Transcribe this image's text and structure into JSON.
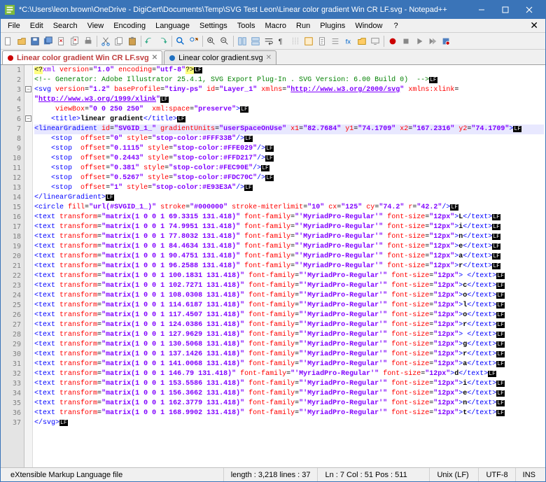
{
  "window": {
    "title": "*C:\\Users\\leon.brown\\OneDrive - DigiCert\\Documents\\Temp\\SVG Test Leon\\Linear color gradient Win CR LF.svg - Notepad++"
  },
  "menu": {
    "items": [
      "File",
      "Edit",
      "Search",
      "View",
      "Encoding",
      "Language",
      "Settings",
      "Tools",
      "Macro",
      "Run",
      "Plugins",
      "Window",
      "?"
    ]
  },
  "tabs": [
    {
      "label": "Linear color gradient Win CR LF.svg",
      "active": true,
      "dirty": true
    },
    {
      "label": "Linear color gradient.svg",
      "active": false,
      "dirty": false
    }
  ],
  "gutter_lines": 37,
  "code_lines": [
    {
      "html": "<span class='c-xml'>&lt;?</span><span class='c-decl'>xml</span> <span class='c-attr'>version</span>=<span class='c-str'>\"1.0\"</span> <span class='c-attr'>encoding</span>=<span class='c-str'>\"utf-8\"</span><span class='c-xml'>?&gt;</span><span class='c-lf'>LF</span>"
    },
    {
      "html": "<span class='c-comment'>&lt;!-- Generator: Adobe Illustrator 25.4.1, SVG Export Plug-In . SVG Version: 6.00 Build 0)  --&gt;</span><span class='c-lf'>LF</span>"
    },
    {
      "html": "<span class='c-tag'>&lt;svg</span> <span class='c-attr'>version</span>=<span class='c-str'>\"1.2\"</span> <span class='c-attr'>baseProfile</span>=<span class='c-str'>\"tiny-ps\"</span> <span class='c-attr'>id</span>=<span class='c-str'>\"Layer_1\"</span> <span class='c-attr'>xmlns</span>=<span class='c-str'>\"<u>http://www.w3.org/2000/svg</u>\"</span> <span class='c-attr'>xmlns:xlink</span>="
    },
    {
      "html": "<span class='c-str'>\"<u>http://www.w3.org/1999/xlink</u>\"</span><span class='c-lf'>LF</span>"
    },
    {
      "html": "     <span class='c-attr'>viewBox</span>=<span class='c-str'>\"0 0 250 250\"</span>  <span class='c-attr'>xml:space</span>=<span class='c-str'>\"preserve\"</span><span class='c-tag'>&gt;</span><span class='c-lf'>LF</span>"
    },
    {
      "html": "    <span class='c-tag'>&lt;title&gt;</span><span class='c-text'>linear gradient</span><span class='c-tag'>&lt;/title&gt;</span><span class='c-lf'>LF</span>"
    },
    {
      "html": "<span class='c-tag'>&lt;linearGradient</span> <span class='c-attr'>id</span>=<span class='c-str'>\"SVGID_1_\"</span> <span class='c-attr'>gradientUnits</span>=<span class='c-str'>\"userSpaceOnUse\"</span> <span class='c-attr'>x1</span>=<span class='c-str'>\"82.7684\"</span> <span class='c-attr'>y1</span>=<span class='c-str'>\"74.1709\"</span> <span class='c-attr'>x2</span>=<span class='c-str'>\"167.2316\"</span> <span class='c-attr'>y2</span>=<span class='c-str'>\"74.1709\"</span><span class='c-tag'>&gt;</span><span class='c-lf'>LF</span>",
      "hl": true
    },
    {
      "html": "    <span class='c-tag'>&lt;stop</span>  <span class='c-attr'>offset</span>=<span class='c-str'>\"0\"</span> <span class='c-attr'>style</span>=<span class='c-str'>\"stop-color:#FFF33B\"</span><span class='c-tag'>/&gt;</span><span class='c-lf'>LF</span>"
    },
    {
      "html": "    <span class='c-tag'>&lt;stop</span>  <span class='c-attr'>offset</span>=<span class='c-str'>\"0.1115\"</span> <span class='c-attr'>style</span>=<span class='c-str'>\"stop-color:#FFE029\"</span><span class='c-tag'>/&gt;</span><span class='c-lf'>LF</span>"
    },
    {
      "html": "    <span class='c-tag'>&lt;stop</span>  <span class='c-attr'>offset</span>=<span class='c-str'>\"0.2443\"</span> <span class='c-attr'>style</span>=<span class='c-str'>\"stop-color:#FFD217\"</span><span class='c-tag'>/&gt;</span><span class='c-lf'>LF</span>"
    },
    {
      "html": "    <span class='c-tag'>&lt;stop</span>  <span class='c-attr'>offset</span>=<span class='c-str'>\"0.381\"</span> <span class='c-attr'>style</span>=<span class='c-str'>\"stop-color:#FEC90E\"</span><span class='c-tag'>/&gt;</span><span class='c-lf'>LF</span>"
    },
    {
      "html": "    <span class='c-tag'>&lt;stop</span>  <span class='c-attr'>offset</span>=<span class='c-str'>\"0.5267\"</span> <span class='c-attr'>style</span>=<span class='c-str'>\"stop-color:#FDC70C\"</span><span class='c-tag'>/&gt;</span><span class='c-lf'>LF</span>"
    },
    {
      "html": "    <span class='c-tag'>&lt;stop</span>  <span class='c-attr'>offset</span>=<span class='c-str'>\"1\"</span> <span class='c-attr'>style</span>=<span class='c-str'>\"stop-color:#E93E3A\"</span><span class='c-tag'>/&gt;</span><span class='c-lf'>LF</span>"
    },
    {
      "html": "<span class='c-tag'>&lt;/linearGradient&gt;</span><span class='c-lf'>LF</span>"
    },
    {
      "html": "<span class='c-tag'>&lt;circle</span> <span class='c-attr'>fill</span>=<span class='c-str'>\"url(#SVGID_1_)\"</span> <span class='c-attr'>stroke</span>=<span class='c-str'>\"#000000\"</span> <span class='c-attr'>stroke-miterlimit</span>=<span class='c-str'>\"10\"</span> <span class='c-attr'>cx</span>=<span class='c-str'>\"125\"</span> <span class='c-attr'>cy</span>=<span class='c-str'>\"74.2\"</span> <span class='c-attr'>r</span>=<span class='c-str'>\"42.2\"</span><span class='c-tag'>/&gt;</span><span class='c-lf'>LF</span>"
    },
    {
      "html": "<span class='c-tag'>&lt;text</span> <span class='c-attr'>transform</span>=<span class='c-str'>\"matrix(1 0 0 1 69.3315 131.418)\"</span> <span class='c-attr'>font-family</span>=<span class='c-str'>\"'MyriadPro-Regular'\"</span> <span class='c-attr'>font-size</span>=<span class='c-str'>\"12px\"</span><span class='c-tag'>&gt;</span><span class='c-text'>L</span><span class='c-tag'>&lt;/text&gt;</span><span class='c-lf'>LF</span>"
    },
    {
      "html": "<span class='c-tag'>&lt;text</span> <span class='c-attr'>transform</span>=<span class='c-str'>\"matrix(1 0 0 1 74.9951 131.418)\"</span> <span class='c-attr'>font-family</span>=<span class='c-str'>\"'MyriadPro-Regular'\"</span> <span class='c-attr'>font-size</span>=<span class='c-str'>\"12px\"</span><span class='c-tag'>&gt;</span><span class='c-text'>i</span><span class='c-tag'>&lt;/text&gt;</span><span class='c-lf'>LF</span>"
    },
    {
      "html": "<span class='c-tag'>&lt;text</span> <span class='c-attr'>transform</span>=<span class='c-str'>\"matrix(1 0 0 1 77.8032 131.418)\"</span> <span class='c-attr'>font-family</span>=<span class='c-str'>\"'MyriadPro-Regular'\"</span> <span class='c-attr'>font-size</span>=<span class='c-str'>\"12px\"</span><span class='c-tag'>&gt;</span><span class='c-text'>n</span><span class='c-tag'>&lt;/text&gt;</span><span class='c-lf'>LF</span>"
    },
    {
      "html": "<span class='c-tag'>&lt;text</span> <span class='c-attr'>transform</span>=<span class='c-str'>\"matrix(1 0 0 1 84.4634 131.418)\"</span> <span class='c-attr'>font-family</span>=<span class='c-str'>\"'MyriadPro-Regular'\"</span> <span class='c-attr'>font-size</span>=<span class='c-str'>\"12px\"</span><span class='c-tag'>&gt;</span><span class='c-text'>e</span><span class='c-tag'>&lt;/text&gt;</span><span class='c-lf'>LF</span>"
    },
    {
      "html": "<span class='c-tag'>&lt;text</span> <span class='c-attr'>transform</span>=<span class='c-str'>\"matrix(1 0 0 1 90.4751 131.418)\"</span> <span class='c-attr'>font-family</span>=<span class='c-str'>\"'MyriadPro-Regular'\"</span> <span class='c-attr'>font-size</span>=<span class='c-str'>\"12px\"</span><span class='c-tag'>&gt;</span><span class='c-text'>a</span><span class='c-tag'>&lt;/text&gt;</span><span class='c-lf'>LF</span>"
    },
    {
      "html": "<span class='c-tag'>&lt;text</span> <span class='c-attr'>transform</span>=<span class='c-str'>\"matrix(1 0 0 1 96.2588 131.418)\"</span> <span class='c-attr'>font-family</span>=<span class='c-str'>\"'MyriadPro-Regular'\"</span> <span class='c-attr'>font-size</span>=<span class='c-str'>\"12px\"</span><span class='c-tag'>&gt;</span><span class='c-text'>r</span><span class='c-tag'>&lt;/text&gt;</span><span class='c-lf'>LF</span>"
    },
    {
      "html": "<span class='c-tag'>&lt;text</span> <span class='c-attr'>transform</span>=<span class='c-str'>\"matrix(1 0 0 1 100.1831 131.418)\"</span> <span class='c-attr'>font-family</span>=<span class='c-str'>\"'MyriadPro-Regular'\"</span> <span class='c-attr'>font-size</span>=<span class='c-str'>\"12px\"</span><span class='c-tag'>&gt;</span><span class='c-text'> </span><span class='c-tag'>&lt;/text&gt;</span><span class='c-lf'>LF</span>"
    },
    {
      "html": "<span class='c-tag'>&lt;text</span> <span class='c-attr'>transform</span>=<span class='c-str'>\"matrix(1 0 0 1 102.7271 131.418)\"</span> <span class='c-attr'>font-family</span>=<span class='c-str'>\"'MyriadPro-Regular'\"</span> <span class='c-attr'>font-size</span>=<span class='c-str'>\"12px\"</span><span class='c-tag'>&gt;</span><span class='c-text'>c</span><span class='c-tag'>&lt;/text&gt;</span><span class='c-lf'>LF</span>"
    },
    {
      "html": "<span class='c-tag'>&lt;text</span> <span class='c-attr'>transform</span>=<span class='c-str'>\"matrix(1 0 0 1 108.0308 131.418)\"</span> <span class='c-attr'>font-family</span>=<span class='c-str'>\"'MyriadPro-Regular'\"</span> <span class='c-attr'>font-size</span>=<span class='c-str'>\"12px\"</span><span class='c-tag'>&gt;</span><span class='c-text'>o</span><span class='c-tag'>&lt;/text&gt;</span><span class='c-lf'>LF</span>"
    },
    {
      "html": "<span class='c-tag'>&lt;text</span> <span class='c-attr'>transform</span>=<span class='c-str'>\"matrix(1 0 0 1 114.6187 131.418)\"</span> <span class='c-attr'>font-family</span>=<span class='c-str'>\"'MyriadPro-Regular'\"</span> <span class='c-attr'>font-size</span>=<span class='c-str'>\"12px\"</span><span class='c-tag'>&gt;</span><span class='c-text'>l</span><span class='c-tag'>&lt;/text&gt;</span><span class='c-lf'>LF</span>"
    },
    {
      "html": "<span class='c-tag'>&lt;text</span> <span class='c-attr'>transform</span>=<span class='c-str'>\"matrix(1 0 0 1 117.4507 131.418)\"</span> <span class='c-attr'>font-family</span>=<span class='c-str'>\"'MyriadPro-Regular'\"</span> <span class='c-attr'>font-size</span>=<span class='c-str'>\"12px\"</span><span class='c-tag'>&gt;</span><span class='c-text'>o</span><span class='c-tag'>&lt;/text&gt;</span><span class='c-lf'>LF</span>"
    },
    {
      "html": "<span class='c-tag'>&lt;text</span> <span class='c-attr'>transform</span>=<span class='c-str'>\"matrix(1 0 0 1 124.0386 131.418)\"</span> <span class='c-attr'>font-family</span>=<span class='c-str'>\"'MyriadPro-Regular'\"</span> <span class='c-attr'>font-size</span>=<span class='c-str'>\"12px\"</span><span class='c-tag'>&gt;</span><span class='c-text'>r</span><span class='c-tag'>&lt;/text&gt;</span><span class='c-lf'>LF</span>"
    },
    {
      "html": "<span class='c-tag'>&lt;text</span> <span class='c-attr'>transform</span>=<span class='c-str'>\"matrix(1 0 0 1 127.9629 131.418)\"</span> <span class='c-attr'>font-family</span>=<span class='c-str'>\"'MyriadPro-Regular'\"</span> <span class='c-attr'>font-size</span>=<span class='c-str'>\"12px\"</span><span class='c-tag'>&gt;</span><span class='c-text'> </span><span class='c-tag'>&lt;/text&gt;</span><span class='c-lf'>LF</span>"
    },
    {
      "html": "<span class='c-tag'>&lt;text</span> <span class='c-attr'>transform</span>=<span class='c-str'>\"matrix(1 0 0 1 130.5068 131.418)\"</span> <span class='c-attr'>font-family</span>=<span class='c-str'>\"'MyriadPro-Regular'\"</span> <span class='c-attr'>font-size</span>=<span class='c-str'>\"12px\"</span><span class='c-tag'>&gt;</span><span class='c-text'>g</span><span class='c-tag'>&lt;/text&gt;</span><span class='c-lf'>LF</span>"
    },
    {
      "html": "<span class='c-tag'>&lt;text</span> <span class='c-attr'>transform</span>=<span class='c-str'>\"matrix(1 0 0 1 137.1426 131.418)\"</span> <span class='c-attr'>font-family</span>=<span class='c-str'>\"'MyriadPro-Regular'\"</span> <span class='c-attr'>font-size</span>=<span class='c-str'>\"12px\"</span><span class='c-tag'>&gt;</span><span class='c-text'>r</span><span class='c-tag'>&lt;/text&gt;</span><span class='c-lf'>LF</span>"
    },
    {
      "html": "<span class='c-tag'>&lt;text</span> <span class='c-attr'>transform</span>=<span class='c-str'>\"matrix(1 0 0 1 141.0068 131.418)\"</span> <span class='c-attr'>font-family</span>=<span class='c-str'>\"'MyriadPro-Regular'\"</span> <span class='c-attr'>font-size</span>=<span class='c-str'>\"12px\"</span><span class='c-tag'>&gt;</span><span class='c-text'>a</span><span class='c-tag'>&lt;/text&gt;</span><span class='c-lf'>LF</span>"
    },
    {
      "html": "<span class='c-tag'>&lt;text</span> <span class='c-attr'>transform</span>=<span class='c-str'>\"matrix(1 0 0 1 146.79 131.418)\"</span> <span class='c-attr'>font-family</span>=<span class='c-str'>\"'MyriadPro-Regular'\"</span> <span class='c-attr'>font-size</span>=<span class='c-str'>\"12px\"</span><span class='c-tag'>&gt;</span><span class='c-text'>d</span><span class='c-tag'>&lt;/text&gt;</span><span class='c-lf'>LF</span>"
    },
    {
      "html": "<span class='c-tag'>&lt;text</span> <span class='c-attr'>transform</span>=<span class='c-str'>\"matrix(1 0 0 1 153.5586 131.418)\"</span> <span class='c-attr'>font-family</span>=<span class='c-str'>\"'MyriadPro-Regular'\"</span> <span class='c-attr'>font-size</span>=<span class='c-str'>\"12px\"</span><span class='c-tag'>&gt;</span><span class='c-text'>i</span><span class='c-tag'>&lt;/text&gt;</span><span class='c-lf'>LF</span>"
    },
    {
      "html": "<span class='c-tag'>&lt;text</span> <span class='c-attr'>transform</span>=<span class='c-str'>\"matrix(1 0 0 1 156.3662 131.418)\"</span> <span class='c-attr'>font-family</span>=<span class='c-str'>\"'MyriadPro-Regular'\"</span> <span class='c-attr'>font-size</span>=<span class='c-str'>\"12px\"</span><span class='c-tag'>&gt;</span><span class='c-text'>e</span><span class='c-tag'>&lt;/text&gt;</span><span class='c-lf'>LF</span>"
    },
    {
      "html": "<span class='c-tag'>&lt;text</span> <span class='c-attr'>transform</span>=<span class='c-str'>\"matrix(1 0 0 1 162.3779 131.418)\"</span> <span class='c-attr'>font-family</span>=<span class='c-str'>\"'MyriadPro-Regular'\"</span> <span class='c-attr'>font-size</span>=<span class='c-str'>\"12px\"</span><span class='c-tag'>&gt;</span><span class='c-text'>n</span><span class='c-tag'>&lt;/text&gt;</span><span class='c-lf'>LF</span>"
    },
    {
      "html": "<span class='c-tag'>&lt;text</span> <span class='c-attr'>transform</span>=<span class='c-str'>\"matrix(1 0 0 1 168.9902 131.418)\"</span> <span class='c-attr'>font-family</span>=<span class='c-str'>\"'MyriadPro-Regular'\"</span> <span class='c-attr'>font-size</span>=<span class='c-str'>\"12px\"</span><span class='c-tag'>&gt;</span><span class='c-text'>t</span><span class='c-tag'>&lt;/text&gt;</span><span class='c-lf'>LF</span>"
    },
    {
      "html": "<span class='c-tag'>&lt;/svg&gt;</span><span class='c-lf'>LF</span>"
    },
    {
      "html": ""
    }
  ],
  "fold_markers": [
    {
      "line": 3,
      "sym": "−"
    },
    {
      "line": 6,
      "sym": "−"
    }
  ],
  "status": {
    "lang": "eXtensible Markup Language file",
    "length": "length : 3,218    lines : 37",
    "pos": "Ln : 7    Col : 51    Pos : 511",
    "sel": "",
    "eol": "Unix (LF)",
    "enc": "UTF-8",
    "ins": "INS"
  }
}
